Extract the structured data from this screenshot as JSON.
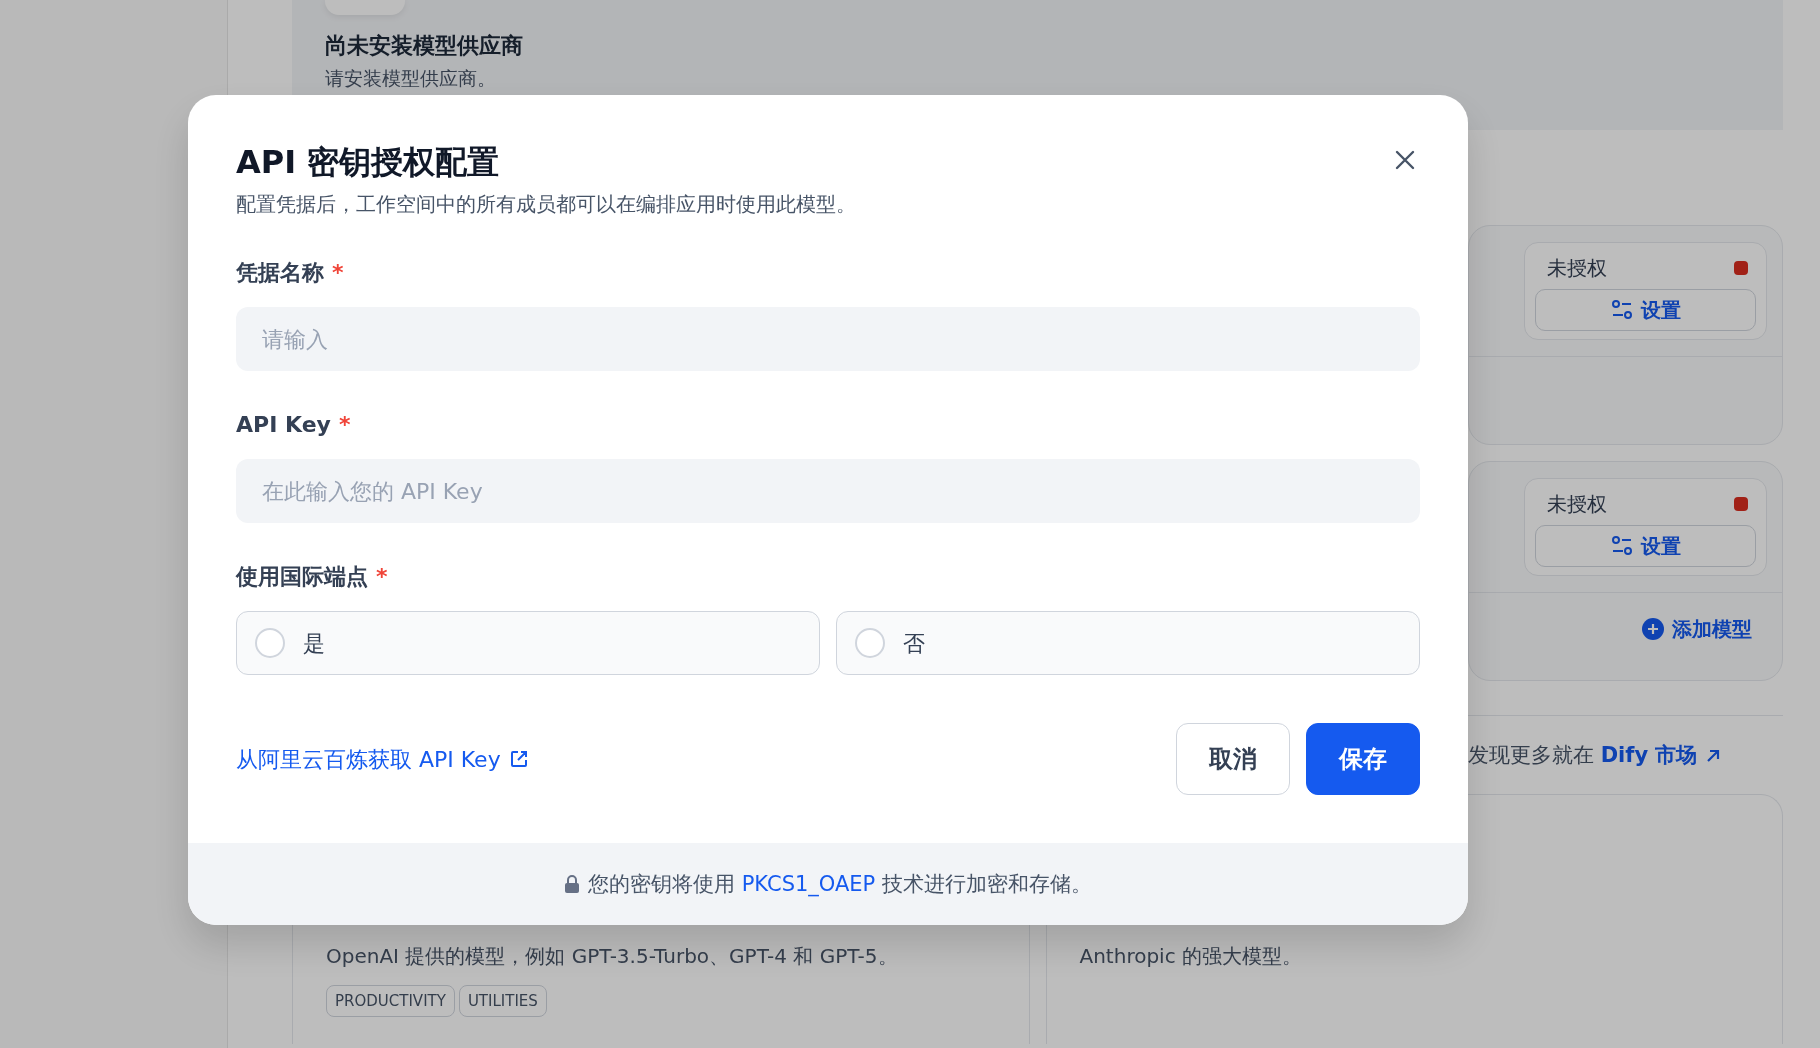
{
  "background": {
    "empty_state": {
      "title": "尚未安装模型供应商",
      "description": "请安装模型供应商。"
    },
    "providers": [
      {
        "status": "未授权",
        "authorized": false,
        "button": "设置"
      },
      {
        "status": "未授权",
        "authorized": false,
        "button": "设置",
        "add_model": "添加模型"
      }
    ],
    "marketplace": {
      "text": "发现更多就在",
      "link": "Dify 市场"
    },
    "plugins": [
      {
        "description": "OpenAI 提供的模型，例如 GPT-3.5-Turbo、GPT-4 和 GPT-5。",
        "tags": [
          "PRODUCTIVITY",
          "UTILITIES"
        ]
      },
      {
        "description": "Anthropic 的强大模型。"
      }
    ]
  },
  "dialog": {
    "title": "API 密钥授权配置",
    "description": "配置凭据后，工作空间中的所有成员都可以在编排应用时使用此模型。",
    "fields": [
      {
        "kind": "text",
        "label": "凭据名称",
        "required_mark": "*",
        "placeholder": "请输入"
      },
      {
        "kind": "text",
        "label": "API Key",
        "required_mark": "*",
        "placeholder": "在此输入您的 API Key"
      },
      {
        "kind": "radio",
        "label": "使用国际端点",
        "required_mark": "*",
        "options": [
          {
            "label": "是",
            "selected": false
          },
          {
            "label": "否",
            "selected": false
          }
        ]
      }
    ],
    "help_link": "从阿里云百炼获取 API Key",
    "buttons": [
      {
        "kind": "secondary",
        "label": "取消"
      },
      {
        "kind": "primary",
        "label": "保存"
      }
    ],
    "footer": {
      "before": "您的密钥将使用",
      "highlight": "PKCS1_OAEP",
      "after": "技术进行加密和存储。"
    }
  }
}
